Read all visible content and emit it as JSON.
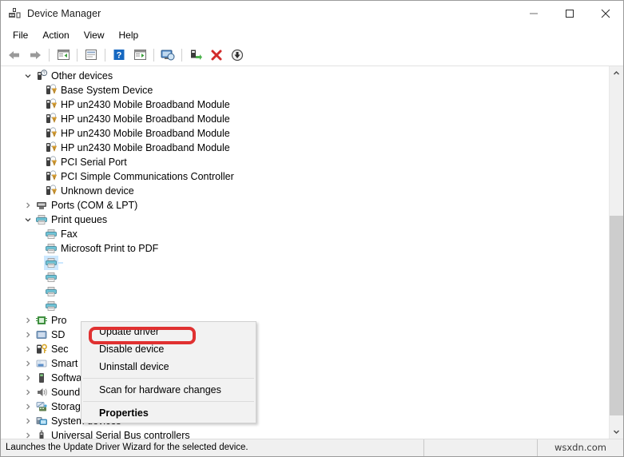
{
  "window": {
    "title": "Device Manager",
    "icon": "device-manager-icon",
    "controls": {
      "minimize": "minimize-icon",
      "maximize": "maximize-icon",
      "close": "close-icon"
    }
  },
  "menubar": {
    "items": [
      {
        "label": "File"
      },
      {
        "label": "Action"
      },
      {
        "label": "View"
      },
      {
        "label": "Help"
      }
    ]
  },
  "toolbar": {
    "buttons": [
      {
        "name": "back-icon"
      },
      {
        "name": "forward-icon"
      },
      {
        "name": "separator"
      },
      {
        "name": "show-hide-console-tree-icon"
      },
      {
        "name": "separator"
      },
      {
        "name": "properties-icon"
      },
      {
        "name": "separator"
      },
      {
        "name": "help-icon"
      },
      {
        "name": "view-icon"
      },
      {
        "name": "separator"
      },
      {
        "name": "scan-for-hardware-changes-icon"
      },
      {
        "name": "separator"
      },
      {
        "name": "update-driver-icon"
      },
      {
        "name": "uninstall-device-icon"
      },
      {
        "name": "disable-device-icon"
      }
    ]
  },
  "tree": {
    "rows": [
      {
        "label": "Other devices",
        "level": 0,
        "expander": "down",
        "icon": "unknown-device-group-icon",
        "selected": false
      },
      {
        "label": "Base System Device",
        "level": 1,
        "expander": "none",
        "icon": "warning-device-icon",
        "selected": false
      },
      {
        "label": "HP un2430 Mobile Broadband Module",
        "level": 1,
        "expander": "none",
        "icon": "warning-device-icon",
        "selected": false
      },
      {
        "label": "HP un2430 Mobile Broadband Module",
        "level": 1,
        "expander": "none",
        "icon": "warning-device-icon",
        "selected": false
      },
      {
        "label": "HP un2430 Mobile Broadband Module",
        "level": 1,
        "expander": "none",
        "icon": "warning-device-icon",
        "selected": false
      },
      {
        "label": "HP un2430 Mobile Broadband Module",
        "level": 1,
        "expander": "none",
        "icon": "warning-device-icon",
        "selected": false
      },
      {
        "label": "PCI Serial Port",
        "level": 1,
        "expander": "none",
        "icon": "warning-device-icon",
        "selected": false
      },
      {
        "label": "PCI Simple Communications Controller",
        "level": 1,
        "expander": "none",
        "icon": "warning-device-icon",
        "selected": false
      },
      {
        "label": "Unknown device",
        "level": 1,
        "expander": "none",
        "icon": "warning-device-icon",
        "selected": false
      },
      {
        "label": "Ports (COM & LPT)",
        "level": 0,
        "expander": "right",
        "icon": "port-icon",
        "selected": false
      },
      {
        "label": "Print queues",
        "level": 0,
        "expander": "down",
        "icon": "printer-icon",
        "selected": false
      },
      {
        "label": "Fax",
        "level": 1,
        "expander": "none",
        "icon": "printer-icon",
        "selected": false
      },
      {
        "label": "Microsoft Print to PDF",
        "level": 1,
        "expander": "none",
        "icon": "printer-icon",
        "selected": false
      },
      {
        "label": "",
        "level": 1,
        "expander": "none",
        "icon": "printer-icon",
        "selected": true
      },
      {
        "label": "",
        "level": 1,
        "expander": "none",
        "icon": "printer-icon",
        "selected": false
      },
      {
        "label": "",
        "level": 1,
        "expander": "none",
        "icon": "printer-icon",
        "selected": false
      },
      {
        "label": "",
        "level": 1,
        "expander": "none",
        "icon": "printer-icon",
        "selected": false
      },
      {
        "label": "Pro",
        "level": 0,
        "expander": "right",
        "icon": "processor-icon",
        "selected": false
      },
      {
        "label": "SD ",
        "level": 0,
        "expander": "right",
        "icon": "sd-host-icon",
        "selected": false
      },
      {
        "label": "Sec",
        "level": 0,
        "expander": "right",
        "icon": "security-device-icon",
        "selected": false
      },
      {
        "label": "Smart card readers",
        "level": 0,
        "expander": "right",
        "icon": "smart-card-reader-icon",
        "selected": false
      },
      {
        "label": "Software devices",
        "level": 0,
        "expander": "right",
        "icon": "software-device-icon",
        "selected": false
      },
      {
        "label": "Sound, video and game controllers",
        "level": 0,
        "expander": "right",
        "icon": "sound-device-icon",
        "selected": false
      },
      {
        "label": "Storage controllers",
        "level": 0,
        "expander": "right",
        "icon": "storage-controller-icon",
        "selected": false
      },
      {
        "label": "System devices",
        "level": 0,
        "expander": "right",
        "icon": "system-device-icon",
        "selected": false
      },
      {
        "label": "Universal Serial Bus controllers",
        "level": 0,
        "expander": "right",
        "icon": "usb-controller-icon",
        "selected": false
      }
    ]
  },
  "context_menu": {
    "items": [
      {
        "label": "Update driver",
        "bold": false,
        "highlighted": true
      },
      {
        "label": "Disable device",
        "bold": false,
        "highlighted": false
      },
      {
        "label": "Uninstall device",
        "bold": false,
        "highlighted": false
      },
      {
        "separator": true
      },
      {
        "label": "Scan for hardware changes",
        "bold": false,
        "highlighted": false
      },
      {
        "separator": true
      },
      {
        "label": "Properties",
        "bold": true,
        "highlighted": false
      }
    ],
    "highlight_color": "#e03131"
  },
  "statusbar": {
    "message": "Launches the Update Driver Wizard for the selected device.",
    "watermark": "wsxdn.com"
  },
  "scrollbar": {
    "up_arrow": "chevron-up-icon",
    "down_arrow": "chevron-down-icon"
  }
}
